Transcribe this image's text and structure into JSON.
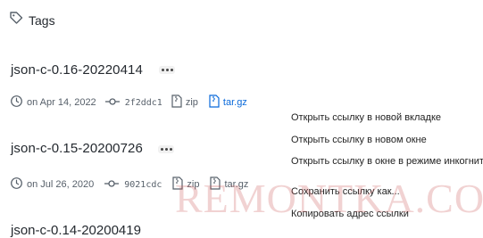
{
  "header": {
    "title": "Tags"
  },
  "tags": [
    {
      "name": "json-c-0.16-20220414",
      "date": "on Apr 14, 2022",
      "commit": "2f2ddc1",
      "zip_label": "zip",
      "targz_label": "tar.gz"
    },
    {
      "name": "json-c-0.15-20200726",
      "date": "on Jul 26, 2020",
      "commit": "9021cdc",
      "zip_label": "zip",
      "targz_label": "tar.gz"
    }
  ],
  "partial_tag": {
    "name": "json-c-0.14-20200419"
  },
  "context_menu": {
    "items": [
      "Открыть ссылку в новой вкладке",
      "Открыть ссылку в новом окне",
      "Открыть ссылку в окне в режиме инкогнито",
      "Сохранить ссылку как...",
      "Копировать адрес ссылки"
    ]
  },
  "watermark": {
    "text": "REMONTKA.COM"
  },
  "colors": {
    "link": "#0969da",
    "text": "#24292f",
    "muted": "#57606a",
    "watermark": "#cd5c5c"
  }
}
